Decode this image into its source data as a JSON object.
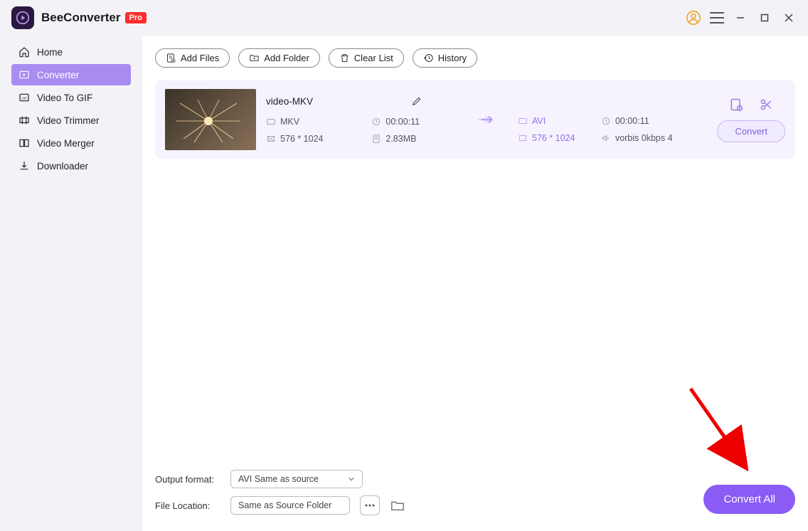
{
  "app": {
    "name": "BeeConverter",
    "badge": "Pro"
  },
  "sidebar": {
    "items": [
      {
        "label": "Home"
      },
      {
        "label": "Converter"
      },
      {
        "label": "Video To GIF"
      },
      {
        "label": "Video Trimmer"
      },
      {
        "label": "Video Merger"
      },
      {
        "label": "Downloader"
      }
    ]
  },
  "toolbar": {
    "add_files": "Add Files",
    "add_folder": "Add Folder",
    "clear_list": "Clear List",
    "history": "History"
  },
  "file": {
    "title": "video-MKV",
    "src_format": "MKV",
    "duration": "00:00:11",
    "resolution": "576 * 1024",
    "size": "2.83MB",
    "dst_format": "AVI",
    "dst_duration": "00:00:11",
    "dst_resolution": "576 * 1024",
    "audio": "vorbis 0kbps 4",
    "convert_label": "Convert"
  },
  "bottom": {
    "output_label": "Output format:",
    "output_value": "AVI Same as source",
    "location_label": "File Location:",
    "location_value": "Same as Source Folder"
  },
  "convert_all": "Convert All"
}
